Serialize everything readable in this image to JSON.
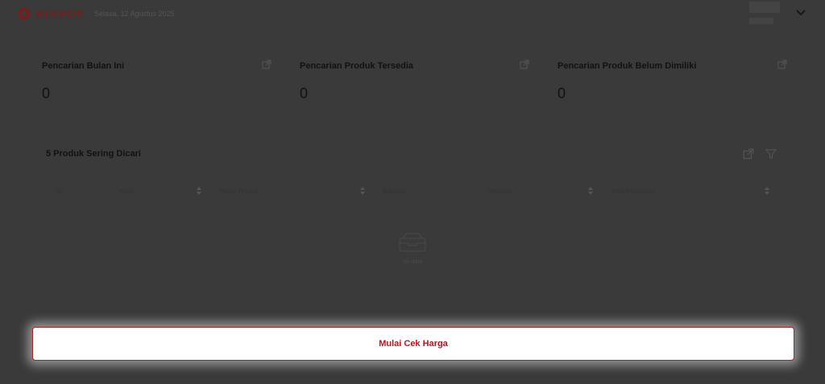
{
  "header": {
    "brand": "BEEPOS",
    "date": "Selasa, 12 Agustus 2025"
  },
  "stats": [
    {
      "title": "Pencarian Bulan Ini",
      "value": "0"
    },
    {
      "title": "Pencarian Produk Tersedia",
      "value": "0"
    },
    {
      "title": "Pencarian Produk Belum Dimiliki",
      "value": "0"
    }
  ],
  "table": {
    "title": "5 Produk Sering Dicari",
    "columns": [
      "No",
      "Kode",
      "Nama Produk",
      "Barcode",
      "Tersedia",
      "Total Pencarian"
    ],
    "empty_text": "No data"
  },
  "cta": {
    "label": "Mulai Cek Harga"
  },
  "colors": {
    "brand": "#7a1c1c",
    "accent": "#c0141c",
    "overlay": "#3a3a3a"
  }
}
